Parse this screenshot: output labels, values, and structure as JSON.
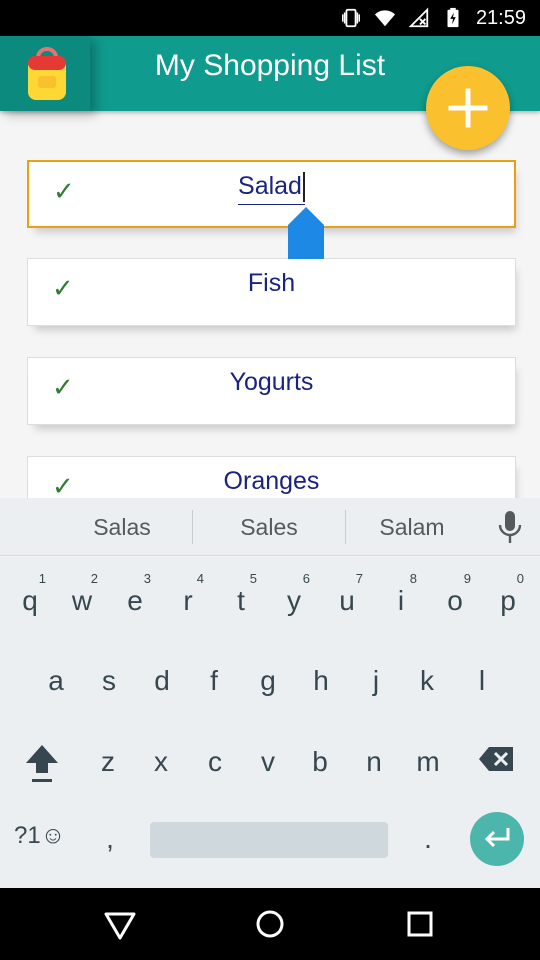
{
  "status_bar": {
    "time": "21:59",
    "icons": [
      "vibrate-icon",
      "wifi-icon",
      "no-signal-icon",
      "battery-charging-icon"
    ]
  },
  "app_bar": {
    "title": "My Shopping List",
    "logo_icon": "shopping-bag-icon",
    "fab_icon": "plus-icon",
    "primary_color": "#0f9b8e",
    "fab_color": "#fbc02d"
  },
  "list": {
    "items": [
      {
        "label": "Salad",
        "checked": true,
        "editing": true
      },
      {
        "label": "Fish",
        "checked": true,
        "editing": false
      },
      {
        "label": "Yogurts",
        "checked": true,
        "editing": false
      },
      {
        "label": "Oranges",
        "checked": true,
        "editing": false
      }
    ],
    "check_glyph": "✓"
  },
  "suggestions": {
    "items": [
      "Salas",
      "Sales",
      "Salam"
    ],
    "mic_icon": "microphone-icon"
  },
  "keyboard": {
    "row1": [
      {
        "k": "q",
        "h": "1"
      },
      {
        "k": "w",
        "h": "2"
      },
      {
        "k": "e",
        "h": "3"
      },
      {
        "k": "r",
        "h": "4"
      },
      {
        "k": "t",
        "h": "5"
      },
      {
        "k": "y",
        "h": "6"
      },
      {
        "k": "u",
        "h": "7"
      },
      {
        "k": "i",
        "h": "8"
      },
      {
        "k": "o",
        "h": "9"
      },
      {
        "k": "p",
        "h": "0"
      }
    ],
    "row2": [
      "a",
      "s",
      "d",
      "f",
      "g",
      "h",
      "j",
      "k",
      "l"
    ],
    "row3": [
      "z",
      "x",
      "c",
      "v",
      "b",
      "n",
      "m"
    ],
    "symbols_label": "?1☺",
    "comma": ",",
    "period": ".",
    "shift_icon": "shift-icon",
    "backspace_icon": "backspace-icon",
    "enter_icon": "enter-icon"
  },
  "nav_bar": {
    "icons": [
      "back-icon",
      "home-icon",
      "recents-icon"
    ]
  }
}
